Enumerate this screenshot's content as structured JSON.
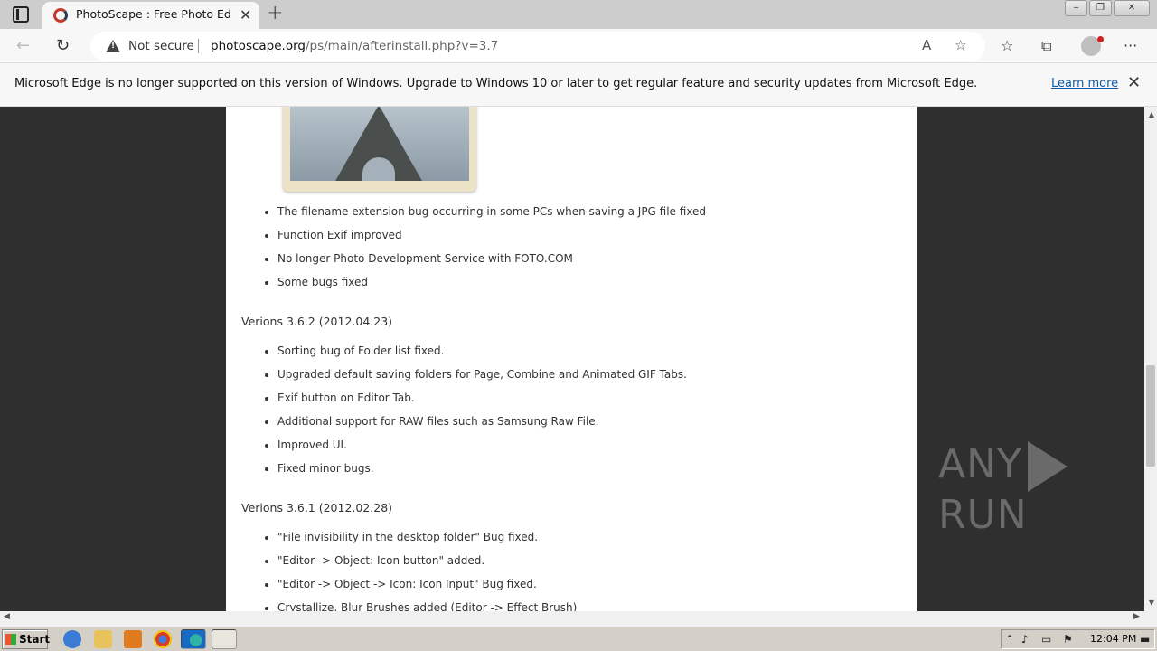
{
  "browser": {
    "tab_title": "PhotoScape : Free Photo Editing",
    "security_label": "Not secure",
    "url_host": "photoscape.org",
    "url_path": "/ps/main/afterinstall.php?v=3.7",
    "window_min": "‒",
    "window_restore": "❐",
    "window_close": "✕"
  },
  "infobar": {
    "message": "Microsoft Edge is no longer supported on this version of Windows. Upgrade to Windows 10 or later to get regular feature and security updates from Microsoft Edge.",
    "link_label": "Learn more"
  },
  "page": {
    "list1": [
      "The filename extension bug occurring in some PCs when saving a JPG file fixed",
      "Function Exif improved",
      "No longer Photo Development Service with FOTO.COM",
      "Some bugs fixed"
    ],
    "version2_heading": "Verions 3.6.2 (2012.04.23)",
    "list2": [
      "Sorting bug of Folder list fixed.",
      "Upgraded default saving folders for Page, Combine and Animated GIF Tabs.",
      "Exif button on Editor Tab.",
      "Additional support for RAW files such as Samsung Raw File.",
      "Improved UI.",
      "Fixed minor bugs."
    ],
    "version3_heading": "Verions 3.6.1 (2012.02.28)",
    "list3": [
      "\"File invisibility in the desktop folder\" Bug fixed.",
      "\"Editor -> Object: Icon button\" added.",
      "\"Editor -> Object -> Icon: Icon Input\" Bug fixed.",
      "Crystallize, Blur Brushes added (Editor -> Effect Brush)"
    ]
  },
  "watermark": {
    "left": "ANY",
    "right": "RUN"
  },
  "taskbar": {
    "start_label": "Start",
    "clock": "12:04 PM"
  },
  "icons": {
    "back": "←",
    "reload": "↻",
    "read_aloud": "A",
    "add_favorite": "☆",
    "favorites": "☆",
    "collections": "⧉",
    "menu": "···",
    "close": "✕",
    "new_tab": "+"
  }
}
